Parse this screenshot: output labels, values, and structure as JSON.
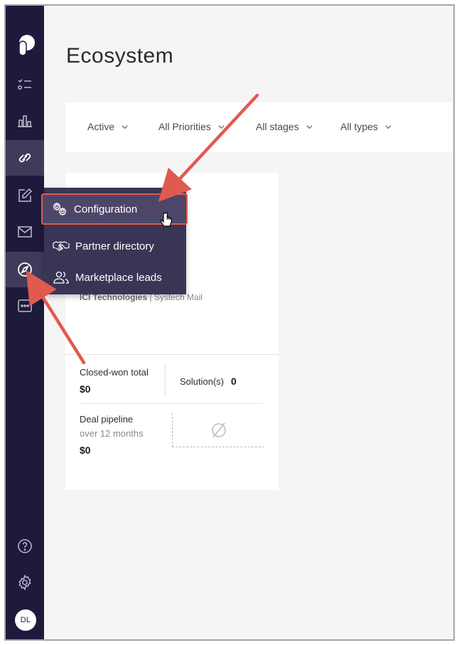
{
  "page": {
    "title": "Ecosystem"
  },
  "sidebar": {
    "items": [
      {
        "name": "tasks-icon"
      },
      {
        "name": "bar-chart-icon"
      },
      {
        "name": "link-icon"
      },
      {
        "name": "edit-icon"
      },
      {
        "name": "mail-icon"
      },
      {
        "name": "compass-icon"
      },
      {
        "name": "chat-icon"
      }
    ],
    "avatar_initials": "DL"
  },
  "filters": [
    {
      "label": "Active"
    },
    {
      "label": "All Priorities"
    },
    {
      "label": "All stages"
    },
    {
      "label": "All types"
    }
  ],
  "menu": {
    "items": [
      {
        "label": "Configuration"
      },
      {
        "label": "Partner directory"
      },
      {
        "label": "Marketplace leads"
      }
    ]
  },
  "card": {
    "company": "ICI Technologies",
    "separator": "|",
    "product": "Systech Mail",
    "closed_won_label": "Closed-won total",
    "closed_won_value": "$0",
    "solutions_label": "Solution(s)",
    "solutions_value": "0",
    "pipeline_label": "Deal pipeline",
    "pipeline_sub": "over 12 months",
    "pipeline_value": "$0"
  },
  "colors": {
    "sidebar": "#1e1a3b",
    "menu": "#3a3555",
    "annotation": "#e05a4f"
  }
}
